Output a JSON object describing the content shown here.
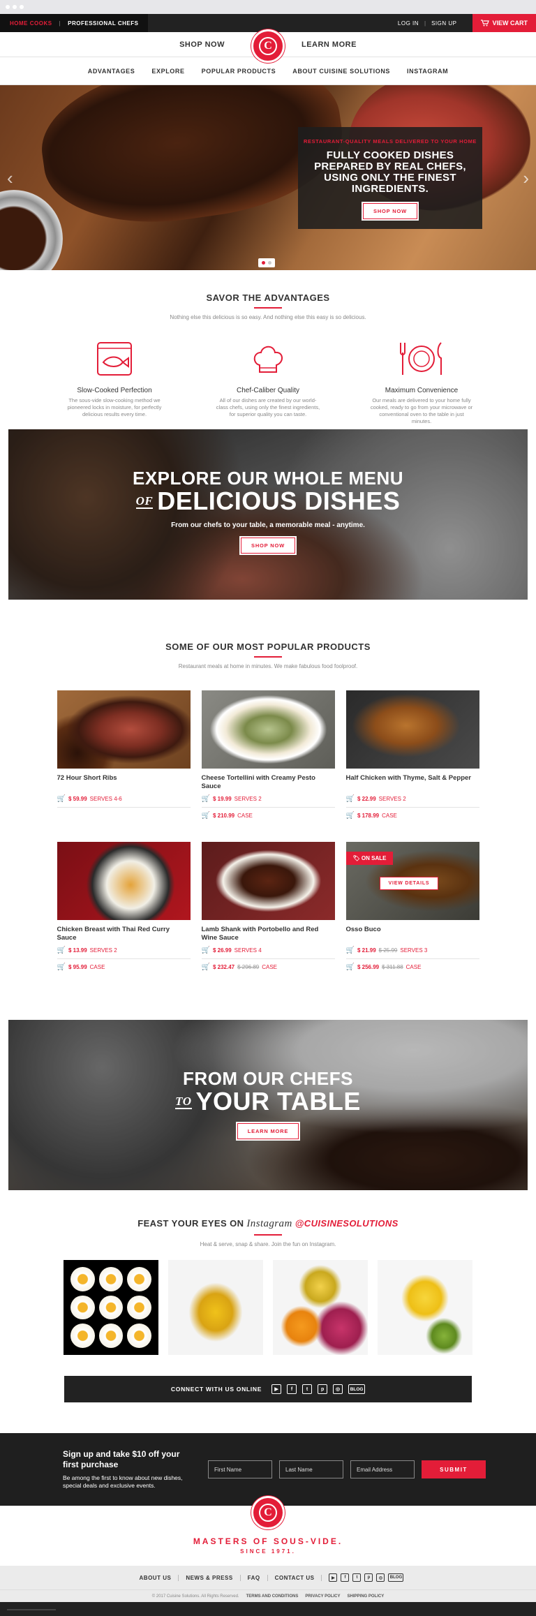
{
  "topbar": {
    "home_cooks": "HOME COOKS",
    "professional_chefs": "PROFESSIONAL CHEFS",
    "divider": "|",
    "log_in": "LOG IN",
    "sign_up": "SIGN UP",
    "view_cart": "VIEW CART"
  },
  "header": {
    "shop_now": "SHOP NOW",
    "learn_more": "LEARN MORE",
    "logo_letter": "C"
  },
  "subnav": [
    "ADVANTAGES",
    "EXPLORE",
    "POPULAR PRODUCTS",
    "ABOUT CUISINE SOLUTIONS",
    "INSTAGRAM"
  ],
  "hero": {
    "kicker": "RESTAURANT-QUALITY MEALS DELIVERED TO YOUR HOME",
    "headline": "FULLY COOKED DISHES PREPARED BY REAL CHEFS, USING ONLY THE FINEST INGREDIENTS.",
    "button": "SHOP NOW",
    "slides": 2,
    "active_slide": 1
  },
  "advantages": {
    "title": "SAVOR THE ADVANTAGES",
    "subtitle": "Nothing else this delicious is so easy. And nothing else this easy is so delicious.",
    "items": [
      {
        "icon": "fish-on-plate-icon",
        "title": "Slow-Cooked Perfection",
        "desc": "The sous-vide slow-cooking method we pioneered locks in moisture, for perfectly delicious results every time."
      },
      {
        "icon": "chef-hat-icon",
        "title": "Chef-Caliber Quality",
        "desc": "All of our dishes are created by our world-class chefs, using only the finest ingredients, for superior quality you can taste."
      },
      {
        "icon": "plate-fork-knife-icon",
        "title": "Maximum Convenience",
        "desc": "Our meals are delivered to your home fully cooked, ready to go from your microwave or conventional oven to the table in just minutes."
      }
    ]
  },
  "explore": {
    "line1": "EXPLORE OUR WHOLE MENU",
    "small": "OF",
    "line2": "DELICIOUS DISHES",
    "sub": "From our chefs to your table, a memorable meal - anytime.",
    "button": "SHOP NOW"
  },
  "products": {
    "title": "SOME OF OUR MOST POPULAR PRODUCTS",
    "subtitle": "Restaurant meals at home in minutes. We make fabulous food foolproof.",
    "sale_label": "ON SALE",
    "view_details": "VIEW DETAILS",
    "items": [
      {
        "name": "72 Hour Short Ribs",
        "rows": [
          {
            "price": "$ 59.99",
            "old": "",
            "unit": "SERVES 4-6"
          }
        ]
      },
      {
        "name": "Cheese Tortellini with Creamy Pesto Sauce",
        "rows": [
          {
            "price": "$ 19.99",
            "old": "",
            "unit": "SERVES 2"
          },
          {
            "price": "$ 210.99",
            "old": "",
            "unit": "CASE"
          }
        ]
      },
      {
        "name": "Half Chicken with Thyme, Salt & Pepper",
        "rows": [
          {
            "price": "$ 22.99",
            "old": "",
            "unit": "SERVES 2"
          },
          {
            "price": "$ 178.99",
            "old": "",
            "unit": "CASE"
          }
        ]
      },
      {
        "name": "Chicken Breast with Thai Red Curry Sauce",
        "rows": [
          {
            "price": "$ 13.99",
            "old": "",
            "unit": "SERVES 2"
          },
          {
            "price": "$ 95.99",
            "old": "",
            "unit": "CASE"
          }
        ]
      },
      {
        "name": "Lamb Shank with Portobello and Red Wine Sauce",
        "rows": [
          {
            "price": "$ 26.99",
            "old": "",
            "unit": "SERVES 4"
          },
          {
            "price": "$ 232.47",
            "old": "$ 296.89",
            "unit": "CASE"
          }
        ]
      },
      {
        "name": "Osso Buco",
        "rows": [
          {
            "price": "$ 21.99",
            "old": "$ 25.99",
            "unit": "SERVES 3"
          },
          {
            "price": "$ 256.99",
            "old": "$ 311.88",
            "unit": "CASE"
          }
        ]
      }
    ]
  },
  "chefs": {
    "line1": "FROM OUR CHEFS",
    "small": "TO",
    "line2": "YOUR TABLE",
    "button": "LEARN MORE"
  },
  "instagram": {
    "prefix": "FEAST YOUR EYES ON",
    "script": "Instagram",
    "handle": "@CUISINESOLUTIONS",
    "subtitle": "Heat & serve, snap & share. Join the fun on Instagram."
  },
  "connect": {
    "label": "CONNECT WITH US ONLINE",
    "icons": [
      "youtube-icon",
      "facebook-icon",
      "twitter-icon",
      "pinterest-icon",
      "instagram-icon",
      "blog-icon"
    ],
    "blog": "BLOG"
  },
  "newsletter": {
    "heading": "Sign up and take $10 off your first purchase",
    "text": "Be among the first to know about new dishes, special deals and exclusive events.",
    "first_name": "First Name",
    "last_name": "Last Name",
    "email": "Email Address",
    "submit": "SUBMIT"
  },
  "footer": {
    "tagline": "MASTERS OF SOUS-VIDE.",
    "since": "SINCE 1971.",
    "links": [
      "ABOUT US",
      "NEWS & PRESS",
      "FAQ",
      "CONTACT US"
    ],
    "blog": "BLOG",
    "copyright": "© 2017 Cuisine Solutions. All Rights Reserved.",
    "terms": "TERMS AND CONDITIONS",
    "privacy": "PRIVACY POLICY",
    "shipping": "SHIPPING POLICY"
  },
  "colors": {
    "accent": "#e31d38",
    "dark": "#222222"
  }
}
